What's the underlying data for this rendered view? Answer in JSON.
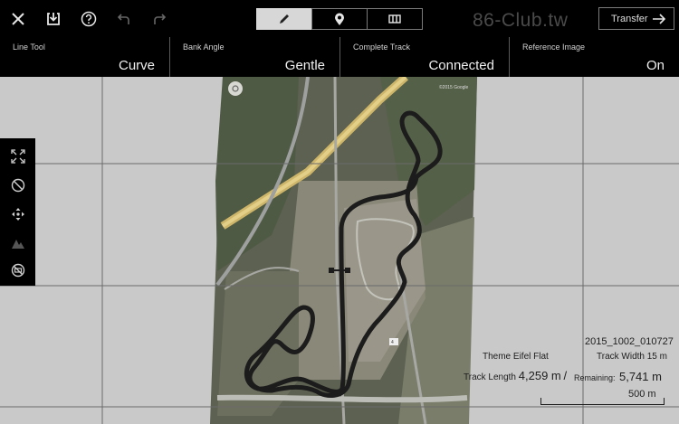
{
  "toolbar": {
    "icons": [
      "close-icon",
      "save-icon",
      "help-icon",
      "undo-icon",
      "redo-icon"
    ],
    "modes": [
      "pencil-icon",
      "map-pin-icon",
      "panel-view-icon"
    ],
    "active_mode": "pencil-icon",
    "watermark": "86-Club.tw",
    "transfer_label": "Transfer"
  },
  "settings": [
    {
      "label": "Line Tool",
      "value": "Curve"
    },
    {
      "label": "Bank Angle",
      "value": "Gentle"
    },
    {
      "label": "Complete Track",
      "value": "Connected"
    },
    {
      "label": "Reference Image",
      "value": "On"
    }
  ],
  "sidebar": {
    "icons": [
      "fit-screen-icon",
      "no-image-icon",
      "move-arrows-icon",
      "elevation-icon",
      "no-entry-icon"
    ]
  },
  "map": {
    "copyright": "©2015 Google",
    "road_label": "4"
  },
  "track_info": {
    "name": "2015_1002_010727",
    "theme_label": "Theme",
    "theme": "Eifel Flat",
    "width_label": "Track Width",
    "width_value": "15 m",
    "length_label": "Track Length",
    "length_value": "4,259 m",
    "separator": "/",
    "remaining_label": "Remaining:",
    "remaining_value": "5,741 m",
    "scale": "500 m"
  },
  "colors": {
    "topbar_bg": "#000000",
    "grid_bg": "#c9c9c9",
    "track": "#1c1c1c",
    "active_mode_bg": "#d7d7d7"
  }
}
